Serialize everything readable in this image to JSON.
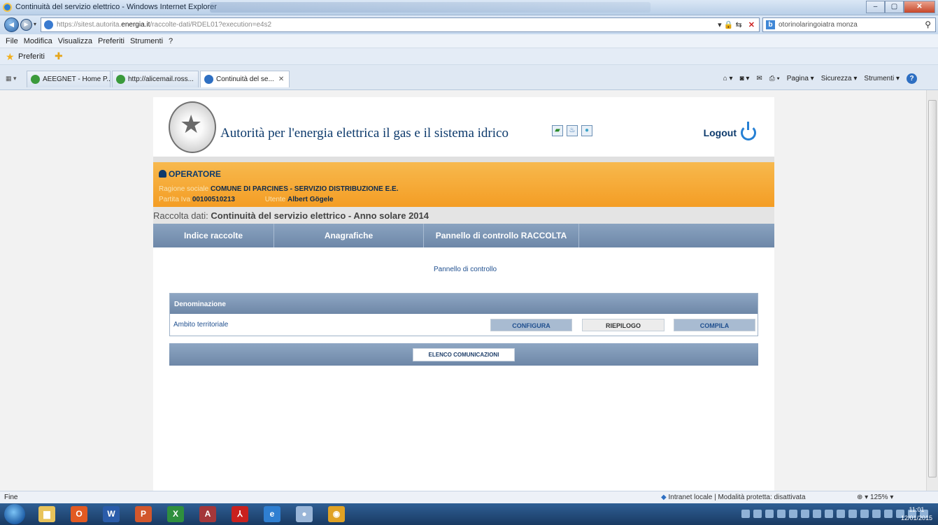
{
  "window": {
    "title": "Continuità del servizio elettrico - Windows Internet Explorer"
  },
  "address": {
    "url_prefix": "https://sitest.autorita.",
    "url_domain": "energia.it",
    "url_path": "/raccolte-dati/RDEL01?execution=e4s2",
    "search_query": "otorinolaringoiatra monza"
  },
  "menu": [
    "File",
    "Modifica",
    "Visualizza",
    "Preferiti",
    "Strumenti",
    "?"
  ],
  "favorites": {
    "label": "Preferiti"
  },
  "tabs": [
    {
      "label": "AEEGNET - Home P...",
      "active": false,
      "icon_color": "#3b9a3b"
    },
    {
      "label": "http://alicemail.ross...",
      "active": false,
      "icon_color": "#3b9a3b"
    },
    {
      "label": "Continuità del se...",
      "active": true,
      "icon_color": "#2e6fc2"
    }
  ],
  "command_bar": [
    "Pagina ▾",
    "Sicurezza ▾",
    "Strumenti ▾"
  ],
  "page": {
    "title": "Autorità per l'energia elettrica il gas e il sistema idrico",
    "logout": "Logout",
    "operator": {
      "heading": "OPERATORE",
      "ragione_sociale_label": "Ragione sociale",
      "ragione_sociale": "COMUNE DI PARCINES - SERVIZIO DISTRIBUZIONE E.E.",
      "partita_iva_label": "Partita Iva",
      "partita_iva": "00100510213",
      "utente_label": "Utente",
      "utente": "Albert Gögele"
    },
    "raccolta": {
      "label": "Raccolta dati:",
      "value": "Continuità del servizio elettrico - Anno solare 2014"
    },
    "nav": [
      "Indice raccolte",
      "Anagrafiche",
      "Pannello di controllo RACCOLTA"
    ],
    "breadcrumb_link": "Pannello di controllo",
    "table": {
      "header": "Denominazione",
      "row_label": "Ambito territoriale",
      "buttons": [
        "CONFIGURA",
        "RIEPILOGO",
        "COMPILA"
      ]
    },
    "elenco_button": "ELENCO COMUNICAZIONI"
  },
  "status": {
    "left": "Fine",
    "zone": "Intranet locale | Modalità protetta: disattivata",
    "zoom": "125%"
  },
  "taskbar": {
    "time": "11:01",
    "date": "12/01/2015",
    "apps": [
      {
        "icon": "folder-icon",
        "glyph": "▆",
        "color": "#e8c35a"
      },
      {
        "icon": "office-icon",
        "glyph": "O",
        "color": "#e25a22"
      },
      {
        "icon": "word-icon",
        "glyph": "W",
        "color": "#2a5caa"
      },
      {
        "icon": "powerpoint-icon",
        "glyph": "P",
        "color": "#d2572c"
      },
      {
        "icon": "excel-icon",
        "glyph": "X",
        "color": "#2f8f3e"
      },
      {
        "icon": "access-icon",
        "glyph": "A",
        "color": "#a4373a"
      },
      {
        "icon": "acrobat-icon",
        "glyph": "⅄",
        "color": "#c9211e"
      },
      {
        "icon": "ie-icon",
        "glyph": "e",
        "color": "#2f7fd1"
      },
      {
        "icon": "ie-pinned-icon",
        "glyph": "●",
        "color": "#9ab6d8"
      },
      {
        "icon": "chrome-icon",
        "glyph": "◉",
        "color": "#e0a224"
      }
    ]
  }
}
